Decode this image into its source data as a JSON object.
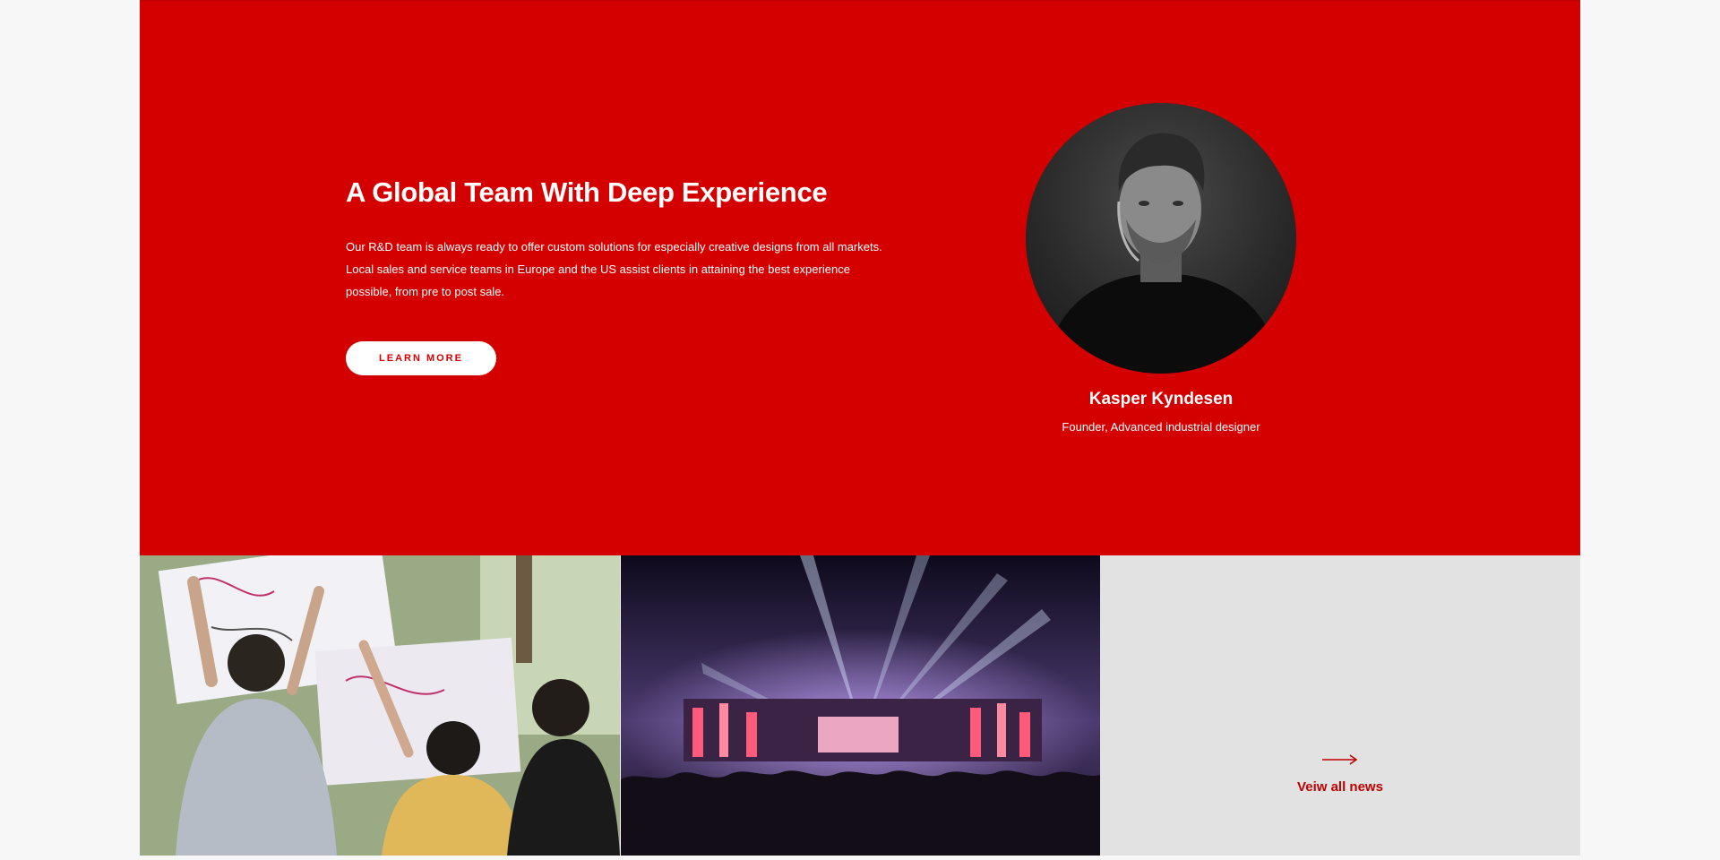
{
  "hero": {
    "title": "A Global Team With Deep Experience",
    "body": "Our R&D team is always ready to offer custom solutions for especially creative designs from all markets. Local sales and service teams in Europe and the US assist clients in attaining the best experience possible, from pre to post sale.",
    "button_label": "LEARN MORE",
    "background_color": "#d40000"
  },
  "person": {
    "name": "Kasper Kyndesen",
    "role": "Founder, Advanced industrial designer"
  },
  "tiles": {
    "news_link_label": "Veiw all news",
    "news_link_icon": "arrow-right-icon",
    "accent_color": "#c00000"
  }
}
